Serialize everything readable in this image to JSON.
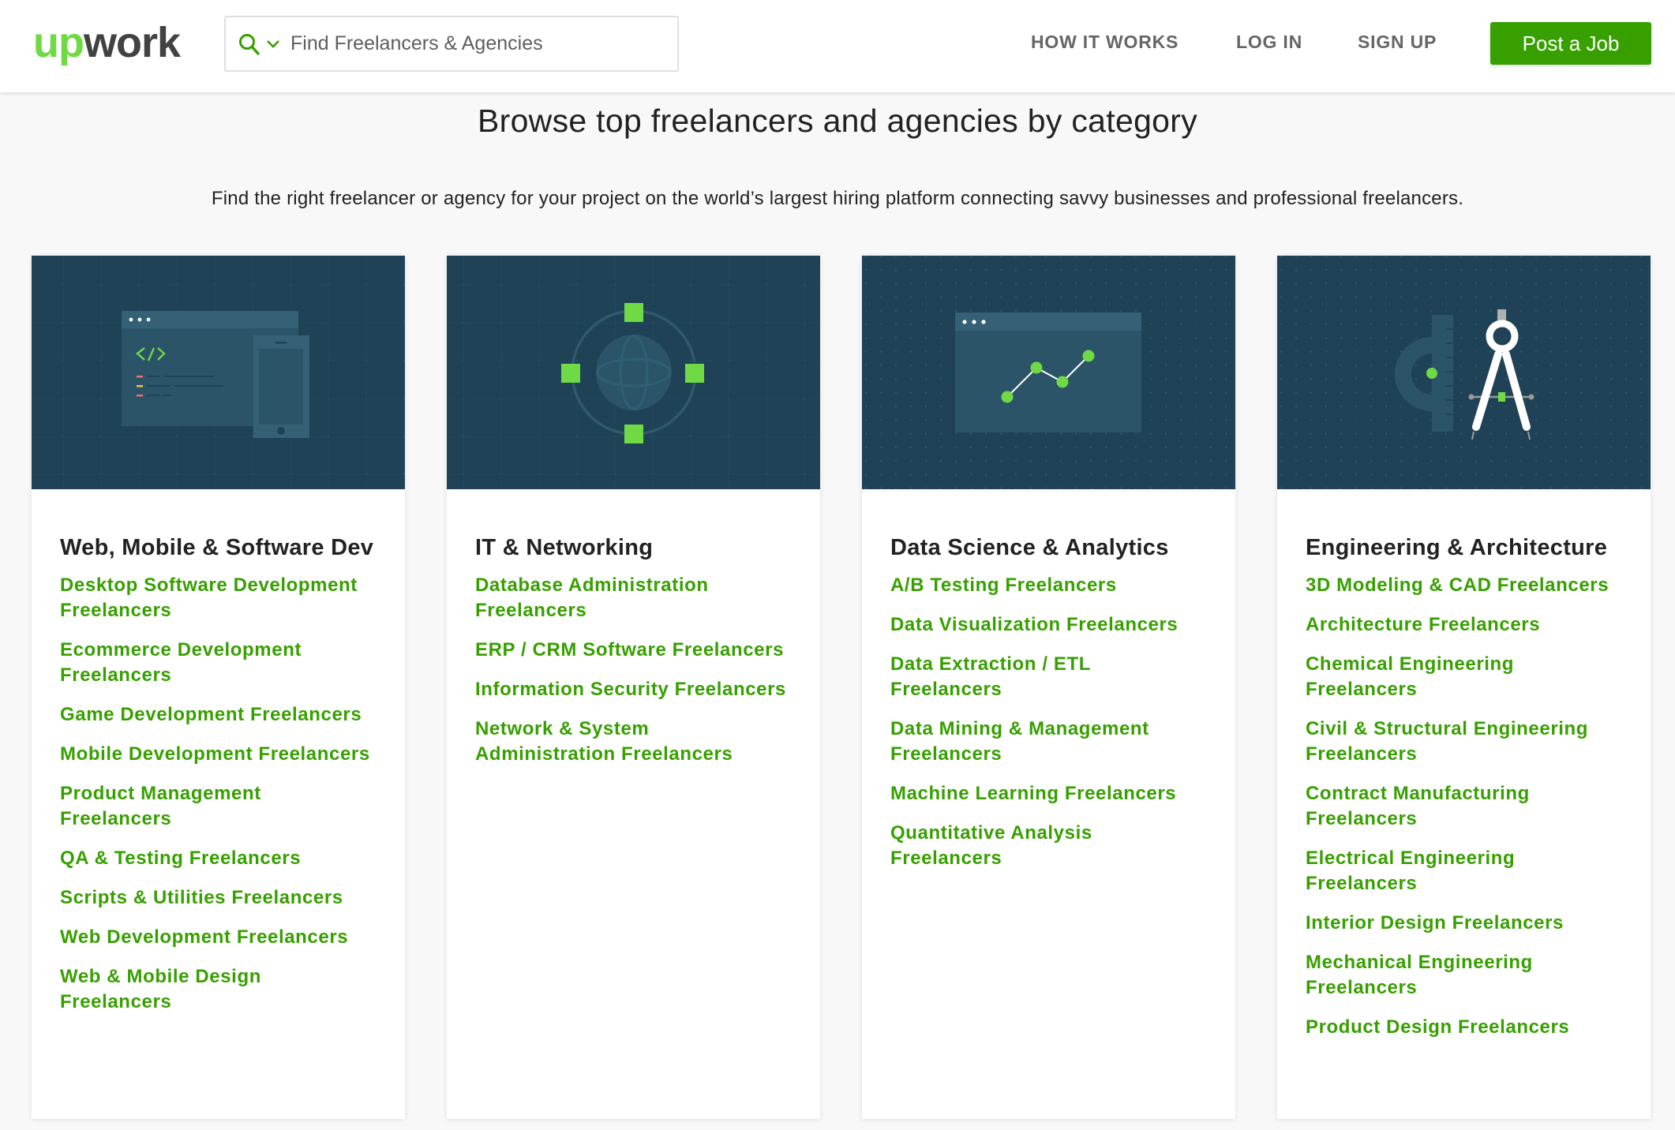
{
  "header": {
    "logo": {
      "part1": "up",
      "part2": "work"
    },
    "search": {
      "placeholder": "Find Freelancers & Agencies",
      "value": ""
    },
    "nav": {
      "how_it_works": "HOW IT WORKS",
      "log_in": "LOG IN",
      "sign_up": "SIGN UP"
    },
    "post_job": "Post a Job"
  },
  "main": {
    "title": "Browse top freelancers and agencies by category",
    "subtitle": "Find the right freelancer or agency for your project on the world’s largest hiring platform connecting savvy businesses and professional freelancers."
  },
  "colors": {
    "brand_green": "#37a000",
    "logo_green": "#6fda44",
    "card_image_bg": "#1f4256"
  },
  "categories": [
    {
      "heading": "Web, Mobile & Software Dev",
      "icon": "code-browser-phone-illustration",
      "links": [
        "Desktop Software Development Freelancers",
        "Ecommerce Development Freelancers",
        "Game Development Freelancers",
        "Mobile Development Freelancers",
        "Product Management Freelancers",
        "QA & Testing Freelancers",
        "Scripts & Utilities Freelancers",
        "Web Development Freelancers",
        "Web & Mobile Design Freelancers"
      ]
    },
    {
      "heading": "IT & Networking",
      "icon": "globe-network-illustration",
      "links": [
        "Database Administration Freelancers",
        "ERP / CRM Software Freelancers",
        "Information Security Freelancers",
        "Network & System Administration Freelancers"
      ]
    },
    {
      "heading": "Data Science & Analytics",
      "icon": "line-chart-browser-illustration",
      "links": [
        "A/B Testing Freelancers",
        "Data Visualization Freelancers",
        "Data Extraction / ETL Freelancers",
        "Data Mining & Management Freelancers",
        "Machine Learning Freelancers",
        "Quantitative Analysis Freelancers"
      ]
    },
    {
      "heading": "Engineering & Architecture",
      "icon": "compass-protractor-illustration",
      "links": [
        "3D Modeling & CAD Freelancers",
        "Architecture Freelancers",
        "Chemical Engineering Freelancers",
        "Civil & Structural Engineering Freelancers",
        "Contract Manufacturing Freelancers",
        "Electrical Engineering Freelancers",
        "Interior Design Freelancers",
        "Mechanical Engineering Freelancers",
        "Product Design Freelancers"
      ]
    }
  ]
}
